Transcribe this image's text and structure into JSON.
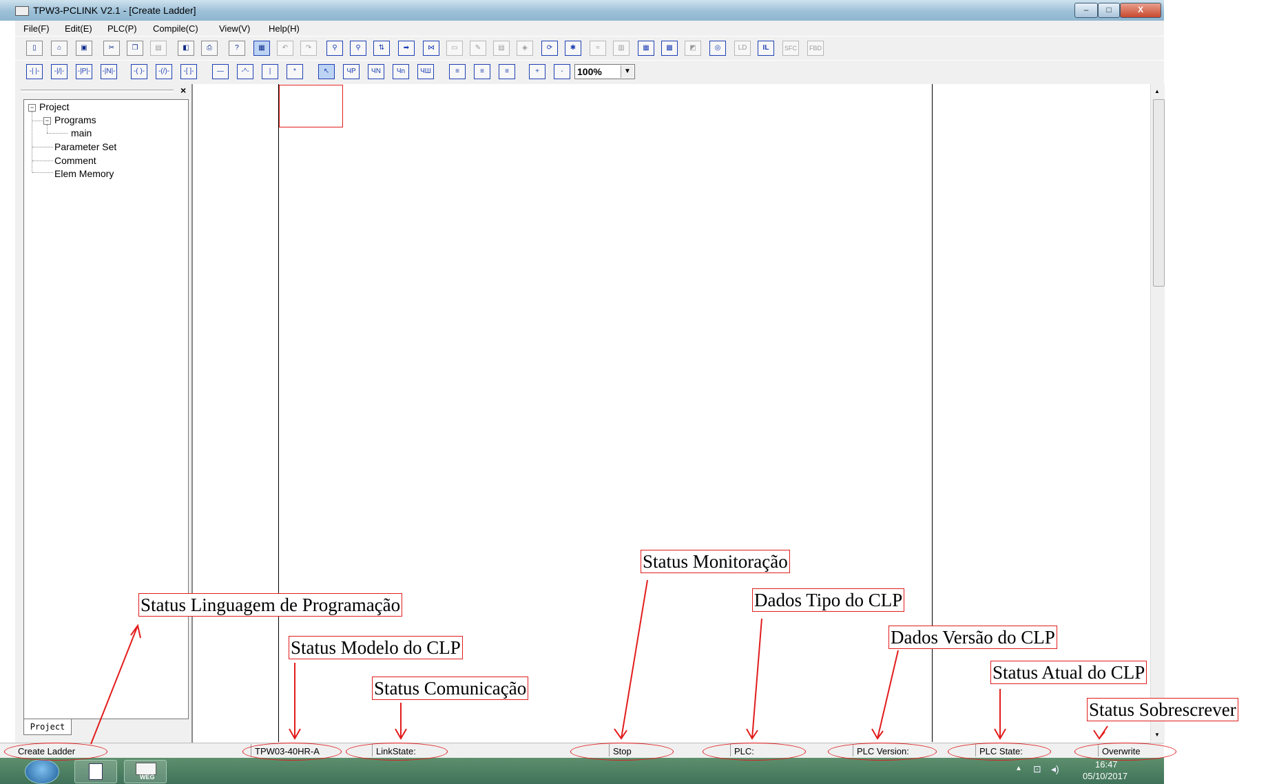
{
  "window": {
    "title": "TPW3-PCLINK V2.1 - [Create Ladder]",
    "minimize_glyph": "–",
    "maximize_glyph": "□",
    "close_glyph": "X"
  },
  "menu": [
    "File(F)",
    "Edit(E)",
    "PLC(P)",
    "Compile(C)",
    "View(V)",
    "Help(H)"
  ],
  "toolbar1": {
    "icons": [
      "new-file-icon",
      "open-folder-icon",
      "save-icon",
      "cut-icon",
      "copy-icon",
      "paste-icon",
      "print-preview-icon",
      "print-icon",
      "help-icon",
      "project-view-icon",
      "undo-icon",
      "redo-icon",
      "find-icon",
      "replace-icon",
      "sort-icon",
      "go-to-icon",
      "compare-icon",
      "doc-icon",
      "edit-doc-icon",
      "list-icon",
      "comment-icon",
      "online-icon",
      "monitor-icon",
      "wave-icon",
      "table-icon",
      "ram-icon",
      "memory-icon",
      "setup-icon",
      "diagnose-icon"
    ],
    "text_buttons": [
      "LD",
      "IL",
      "SFC",
      "FBD"
    ]
  },
  "toolbar2": {
    "buttons": [
      "-| |-",
      "-|/|-",
      "-|P|-",
      "-|N|-",
      "-( )-",
      "-(/)-",
      "-[ ]-",
      "—",
      "-^-",
      "|",
      "*",
      "↖",
      "ЧP",
      "ЧN",
      "Чn",
      "ЧШ",
      "≡",
      "≡",
      "≡",
      "+",
      "-"
    ],
    "zoom": "100%"
  },
  "tree": {
    "close_glyph": "×",
    "project": "Project",
    "programs": "Programs",
    "main": "main",
    "parameter_set": "Parameter Set",
    "comment": "Comment",
    "elem_memory": "Elem Memory",
    "tab": "Project"
  },
  "statusbar": {
    "language": "Create Ladder",
    "model": "TPW03-40HR-A",
    "link": "LinkState:",
    "monitor": "Stop",
    "plc": "PLC:",
    "version": "PLC Version:",
    "state": "PLC State:",
    "mode": "Overwrite"
  },
  "taskbar": {
    "time": "16:47",
    "date": "05/10/2017",
    "app_label": "WEG"
  },
  "annotations": {
    "language": "Status Linguagem de Programação",
    "model": "Status Modelo do CLP",
    "communication": "Status Comunicação",
    "monitor": "Status Monitoração",
    "plc_type": "Dados Tipo do CLP",
    "plc_version": "Dados Versão do CLP",
    "plc_state": "Status Atual do CLP",
    "overwrite": "Status Sobrescrever"
  },
  "colors": {
    "annotation": "#e21b1b",
    "taskbar": "#3f7259",
    "toolbar_icon": "#1d3fb4"
  }
}
